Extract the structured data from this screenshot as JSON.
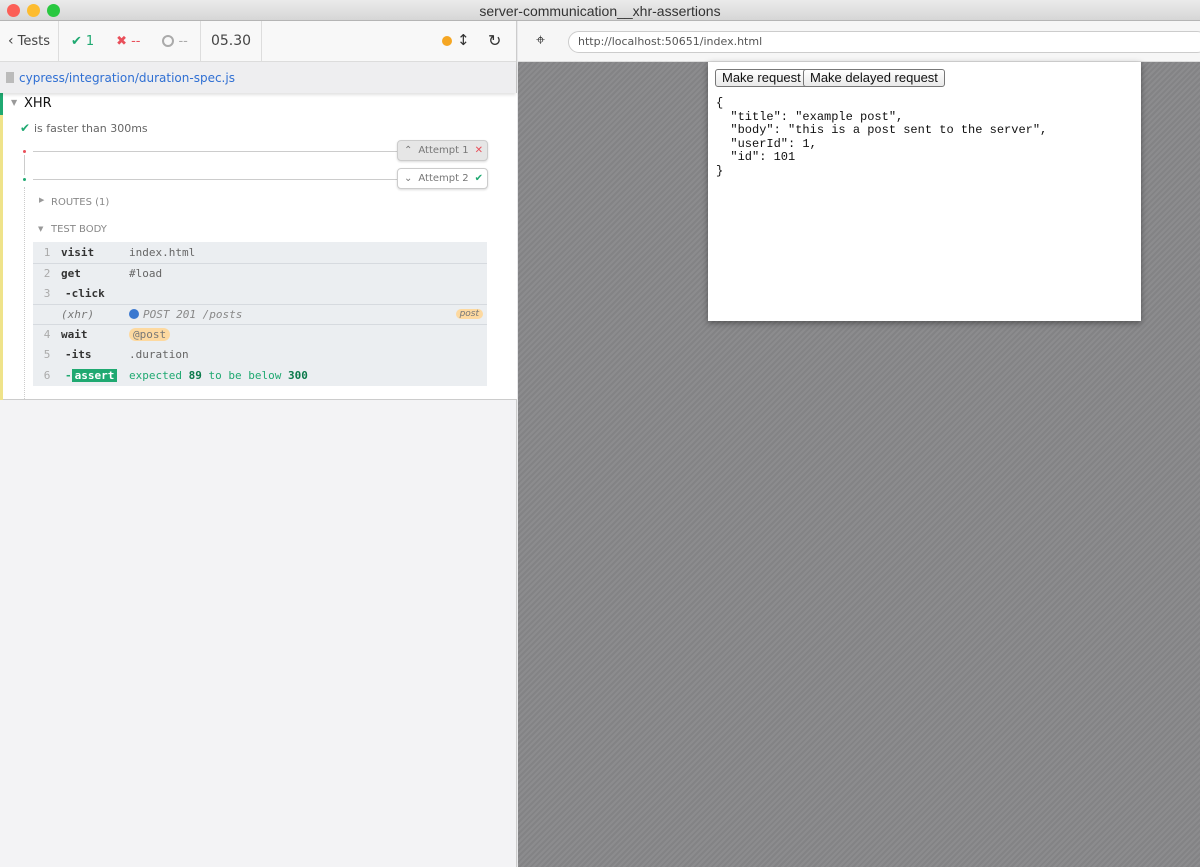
{
  "window": {
    "title": "server-communication__xhr-assertions"
  },
  "toolbar": {
    "back_label": "Tests",
    "passed": "1",
    "failed": "--",
    "pending": "--",
    "duration": "05.30"
  },
  "spec": {
    "path": "cypress/integration/duration-spec.js"
  },
  "suite": {
    "title": "XHR",
    "test": "is faster than 300ms",
    "attempts": [
      {
        "label": "Attempt 1",
        "state": "failed"
      },
      {
        "label": "Attempt 2",
        "state": "passed"
      }
    ],
    "routes_label": "ROUTES (1)",
    "body_label": "TEST BODY"
  },
  "commands": [
    {
      "num": "1",
      "name": "visit",
      "msg": "index.html"
    },
    {
      "num": "2",
      "name": "get",
      "msg": "#load"
    },
    {
      "num": "3",
      "name": "-click",
      "msg": ""
    },
    {
      "num": "",
      "name": "(xhr)",
      "msg": "POST 201 /posts",
      "alias": "post"
    },
    {
      "num": "4",
      "name": "wait",
      "msg": "@post"
    },
    {
      "num": "5",
      "name": "-its",
      "msg": ".duration"
    },
    {
      "num": "6",
      "name": "-assert",
      "msg_parts": [
        "expected",
        "89",
        "to be below",
        "300"
      ]
    }
  ],
  "browser": {
    "url": "http://localhost:50651/index.html"
  },
  "app": {
    "buttons": [
      "Make request",
      "Make delayed request"
    ],
    "output": "{\n  \"title\": \"example post\",\n  \"body\": \"this is a post sent to the server\",\n  \"userId\": 1,\n  \"id\": 101\n}"
  },
  "colors": {
    "pass": "#1fa971",
    "fail": "#e94f5a",
    "link": "#2f6fd3",
    "alias": "#fdd9a0",
    "running": "#f5a623"
  }
}
